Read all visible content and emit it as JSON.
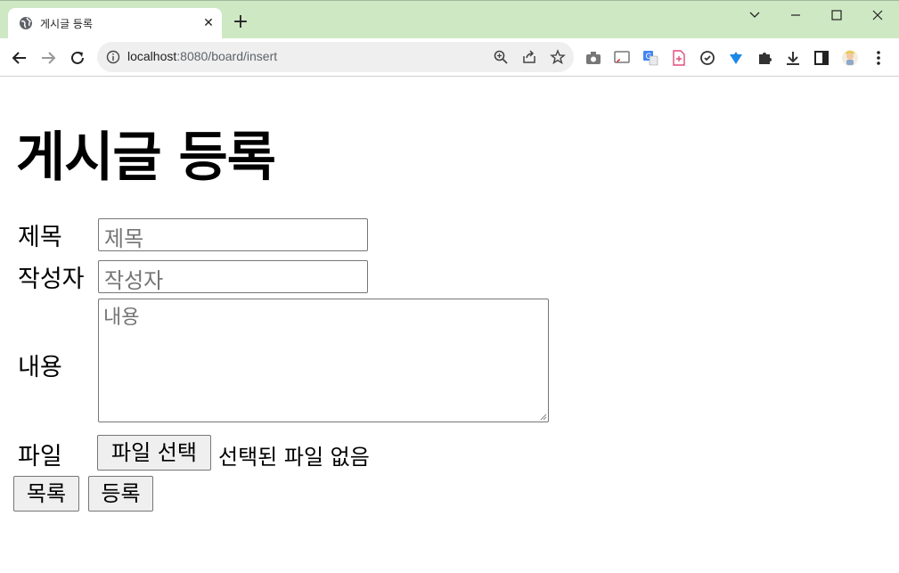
{
  "browser": {
    "tab_title": "게시글 등록",
    "tab_close": "✕",
    "new_tab": "+",
    "url_host": "localhost",
    "url_path": ":8080/board/insert"
  },
  "page": {
    "heading": "게시글 등록",
    "form": {
      "title_label": "제목",
      "title_placeholder": "제목",
      "writer_label": "작성자",
      "writer_placeholder": "작성자",
      "content_label": "내용",
      "content_placeholder": "내용",
      "file_label": "파일",
      "file_button": "파일 선택",
      "file_status": "선택된 파일 없음"
    },
    "buttons": {
      "list": "목록",
      "submit": "등록"
    }
  },
  "colors": {
    "tabbar_bg": "#cfe8c4",
    "omnibox_bg": "#efefef",
    "button_bg": "#efefef"
  }
}
